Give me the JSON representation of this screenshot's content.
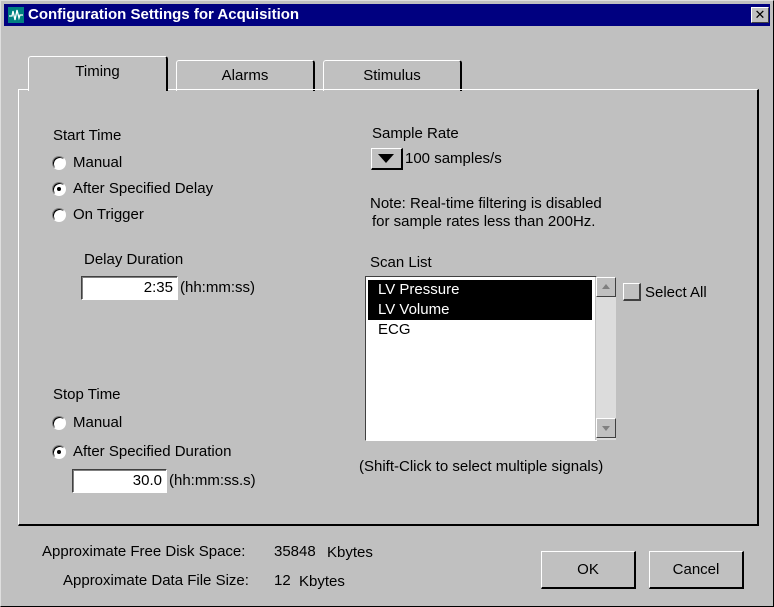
{
  "window": {
    "title": "Configuration Settings for Acquisition",
    "close_glyph": "✕"
  },
  "tabs": [
    {
      "label": "Timing",
      "active": true
    },
    {
      "label": "Alarms",
      "active": false
    },
    {
      "label": "Stimulus",
      "active": false
    }
  ],
  "start_time": {
    "heading": "Start Time",
    "options": [
      {
        "label": "Manual",
        "selected": false
      },
      {
        "label": "After Specified Delay",
        "selected": true
      },
      {
        "label": "On Trigger",
        "selected": false
      }
    ],
    "delay_label": "Delay Duration",
    "delay_value": "2:35",
    "delay_unit": "(hh:mm:ss)"
  },
  "stop_time": {
    "heading": "Stop Time",
    "options": [
      {
        "label": "Manual",
        "selected": false
      },
      {
        "label": "After Specified Duration",
        "selected": true
      }
    ],
    "duration_value": "30.0",
    "duration_unit": "(hh:mm:ss.s)"
  },
  "sample_rate": {
    "heading": "Sample Rate",
    "value": "100 samples/s",
    "note_line1": "Note: Real-time filtering is disabled",
    "note_line2": "for sample rates less than 200Hz."
  },
  "scan_list": {
    "heading": "Scan List",
    "items": [
      {
        "label": "LV Pressure",
        "selected": true
      },
      {
        "label": "LV Volume",
        "selected": true
      },
      {
        "label": "ECG",
        "selected": false
      }
    ],
    "select_all_label": "Select All",
    "hint": "(Shift-Click to select multiple signals)"
  },
  "footer": {
    "free_space_label": "Approximate Free Disk Space:",
    "free_space_value": "35848",
    "free_space_unit": "Kbytes",
    "file_size_label": "Approximate Data File Size:",
    "file_size_value": "12",
    "file_size_unit": "Kbytes"
  },
  "buttons": {
    "ok": "OK",
    "cancel": "Cancel"
  },
  "icons": {
    "title_icon": "waveform-icon",
    "close": "close-icon",
    "dropdown": "triangle-down-icon",
    "scroll_up": "arrow-up-icon",
    "scroll_down": "arrow-down-icon"
  }
}
